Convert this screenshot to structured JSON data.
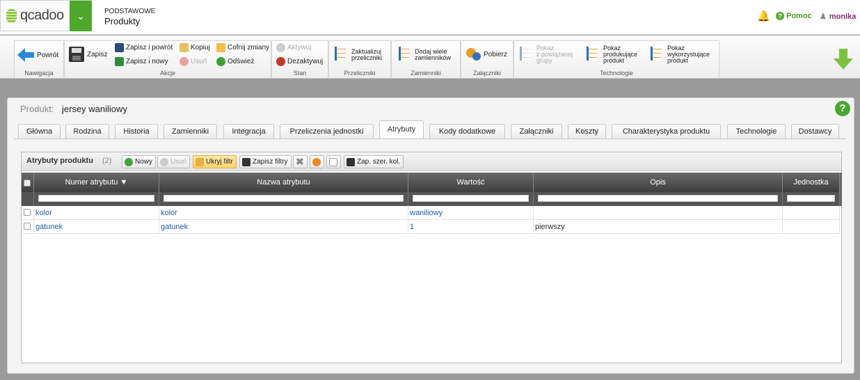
{
  "app": {
    "logo": "qcadoo",
    "section": "PODSTAWOWE",
    "page": "Produkty"
  },
  "header": {
    "help": "Pomoc",
    "user": "monika"
  },
  "ribbon": {
    "nav": {
      "back": "Powrót",
      "label": "Nawigacja"
    },
    "actions": {
      "save": "Zapisz",
      "save_back": "Zapisz i powrót",
      "save_new": "Zapisz i nowy",
      "copy": "Kopiuj",
      "delete": "Usuń",
      "undo": "Cofnij zmiany",
      "refresh": "Odśwież",
      "label": "Akcje"
    },
    "state": {
      "activate": "Aktywuj",
      "deactivate": "Dezaktywuj",
      "label": "Stan"
    },
    "conv": {
      "update": [
        "Zaktualizuj",
        "przeliczniki"
      ],
      "label": "Przeliczniki"
    },
    "subst": {
      "add": [
        "Dodaj wiele",
        "zamienników"
      ],
      "label": "Zamienniki"
    },
    "attach": {
      "download": "Pobierz",
      "label": "Załączniki"
    },
    "tech": {
      "show_group": [
        "Pokaż",
        "z powiązanej",
        "grupy"
      ],
      "show_producing": [
        "Pokaż",
        "produkujące",
        "produkt"
      ],
      "show_using": [
        "Pokaż",
        "wykorzystujące",
        "produkt"
      ],
      "label": "Technologie"
    }
  },
  "panel": {
    "label": "Produkt:",
    "value": "jersey waniliowy"
  },
  "tabs": [
    "Główna",
    "Rodzina",
    "Historia",
    "Zamienniki",
    "Integracja",
    "Przeliczenia jednostki",
    "Atrybuty",
    "Kody dodatkowe",
    "Załączniki",
    "Koszty",
    "Charakterystyka produktu",
    "Technologie",
    "Dostawcy"
  ],
  "grid": {
    "title": "Atrybuty produktu",
    "count": "(2)",
    "toolbar": {
      "new": "Nowy",
      "delete": "Usuń",
      "hide_filter": "Ukryj filtr",
      "save_filters": "Zapisz filtry",
      "save_widths": "Zap. szer. kol."
    },
    "columns": [
      "Numer atrybutu",
      "Nazwa atrybutu",
      "Wartość",
      "Opis",
      "Jednostka"
    ],
    "rows": [
      [
        "kolor",
        "kolor",
        "waniliowy",
        "",
        ""
      ],
      [
        "gatunek",
        "gatunek",
        "1",
        "pierwszy",
        ""
      ]
    ]
  },
  "colors": {
    "brand": "#4da82b",
    "link": "#1f5fa8",
    "header_dark": "#3e3e3e"
  }
}
